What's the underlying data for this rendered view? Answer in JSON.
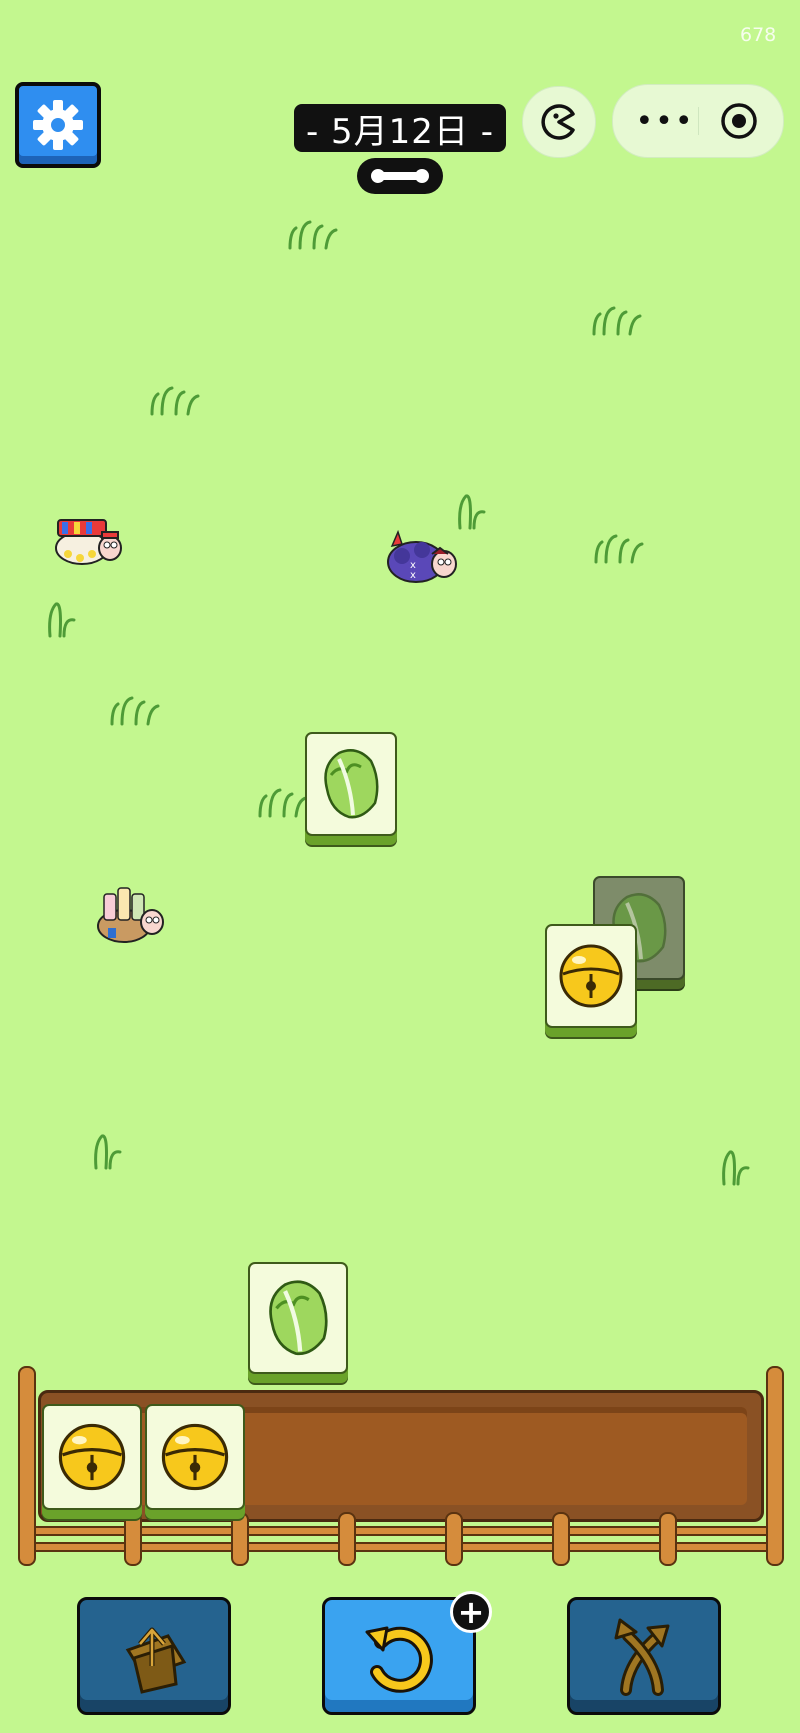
{
  "hud": {
    "fps": "678",
    "date": "- 5月12日 -",
    "settings_icon": "gear-icon",
    "share_icon": "pacman-face-icon",
    "more_label": "•••",
    "close_icon": "target-circle-icon",
    "progress_icon": "bone-progress-bar"
  },
  "board": {
    "tiles": [
      {
        "icon": "cabbage-icon",
        "state": "free"
      },
      {
        "icon": "cabbage-icon",
        "state": "covered"
      },
      {
        "icon": "bell-icon",
        "state": "free"
      },
      {
        "icon": "cabbage-icon",
        "state": "free"
      }
    ],
    "sheep": [
      "popcorn-sheep-icon",
      "devil-sheep-icon",
      "drinks-sheep-icon"
    ]
  },
  "tray": {
    "capacity": 7,
    "slots": [
      {
        "icon": "bell-icon"
      },
      {
        "icon": "bell-icon"
      }
    ]
  },
  "toolbar": {
    "move_out_icon": "move-out-box-icon",
    "undo_icon": "undo-arrow-icon",
    "undo_badge": "+",
    "shuffle_icon": "shuffle-arrows-icon"
  },
  "colors": {
    "background": "#c3f78f",
    "tile_face": "#f4fbdc",
    "tile_edge": "#6aa22a",
    "tray_wood": "#8a5124",
    "button_blue": "#3aa3f0",
    "button_dark": "#25638f"
  }
}
